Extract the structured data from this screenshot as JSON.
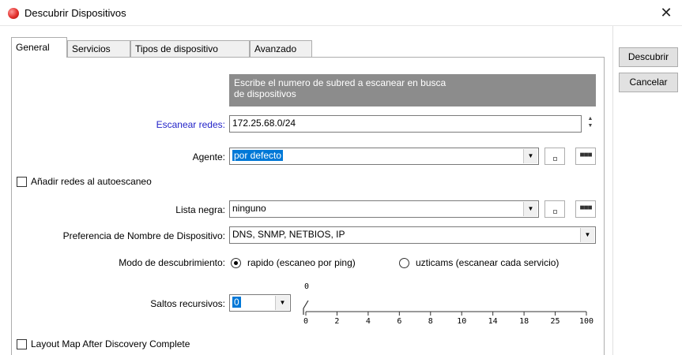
{
  "window": {
    "title": "Descubrir Dispositivos",
    "close_glyph": "✕",
    "icon": "app-icon"
  },
  "tabs": [
    {
      "label": "General",
      "active": true
    },
    {
      "label": "Servicios",
      "active": false
    },
    {
      "label": "Tipos de dispositivo",
      "active": false
    },
    {
      "label": "Avanzado",
      "active": false
    }
  ],
  "actions": {
    "discover": "Descubrir",
    "cancel": "Cancelar"
  },
  "banner": {
    "line1": "Escribe el numero de subred a escanear en busca",
    "line2": "de dispositivos"
  },
  "scan": {
    "label": "Escanear redes:",
    "value": "172.25.68.0/24"
  },
  "agent": {
    "label": "Agente:",
    "value": "por defecto"
  },
  "autoscan": {
    "label": "Añadir redes al autoescaneo",
    "checked": false
  },
  "blacklist": {
    "label": "Lista negra:",
    "value": "ninguno"
  },
  "name_pref": {
    "label": "Preferencia de Nombre de Dispositivo:",
    "value": "DNS, SNMP, NETBIOS, IP"
  },
  "mode": {
    "label": "Modo de descubrimiento:",
    "option1": "rapido (escaneo por ping)",
    "option2": "uzticams (escanear cada servicio)",
    "selected": "option1"
  },
  "hops": {
    "label": "Saltos recursivos:",
    "value": "0",
    "slider_current": "0",
    "ticks": [
      "0",
      "2",
      "4",
      "6",
      "8",
      "10",
      "14",
      "18",
      "25",
      "100"
    ],
    "slider_index": 0
  },
  "layout_map": {
    "label": "Layout Map After Discovery Complete",
    "checked": false
  },
  "colors": {
    "selection": "#0078d7",
    "link_label": "#2323c8",
    "banner": "#8c8c8c"
  }
}
